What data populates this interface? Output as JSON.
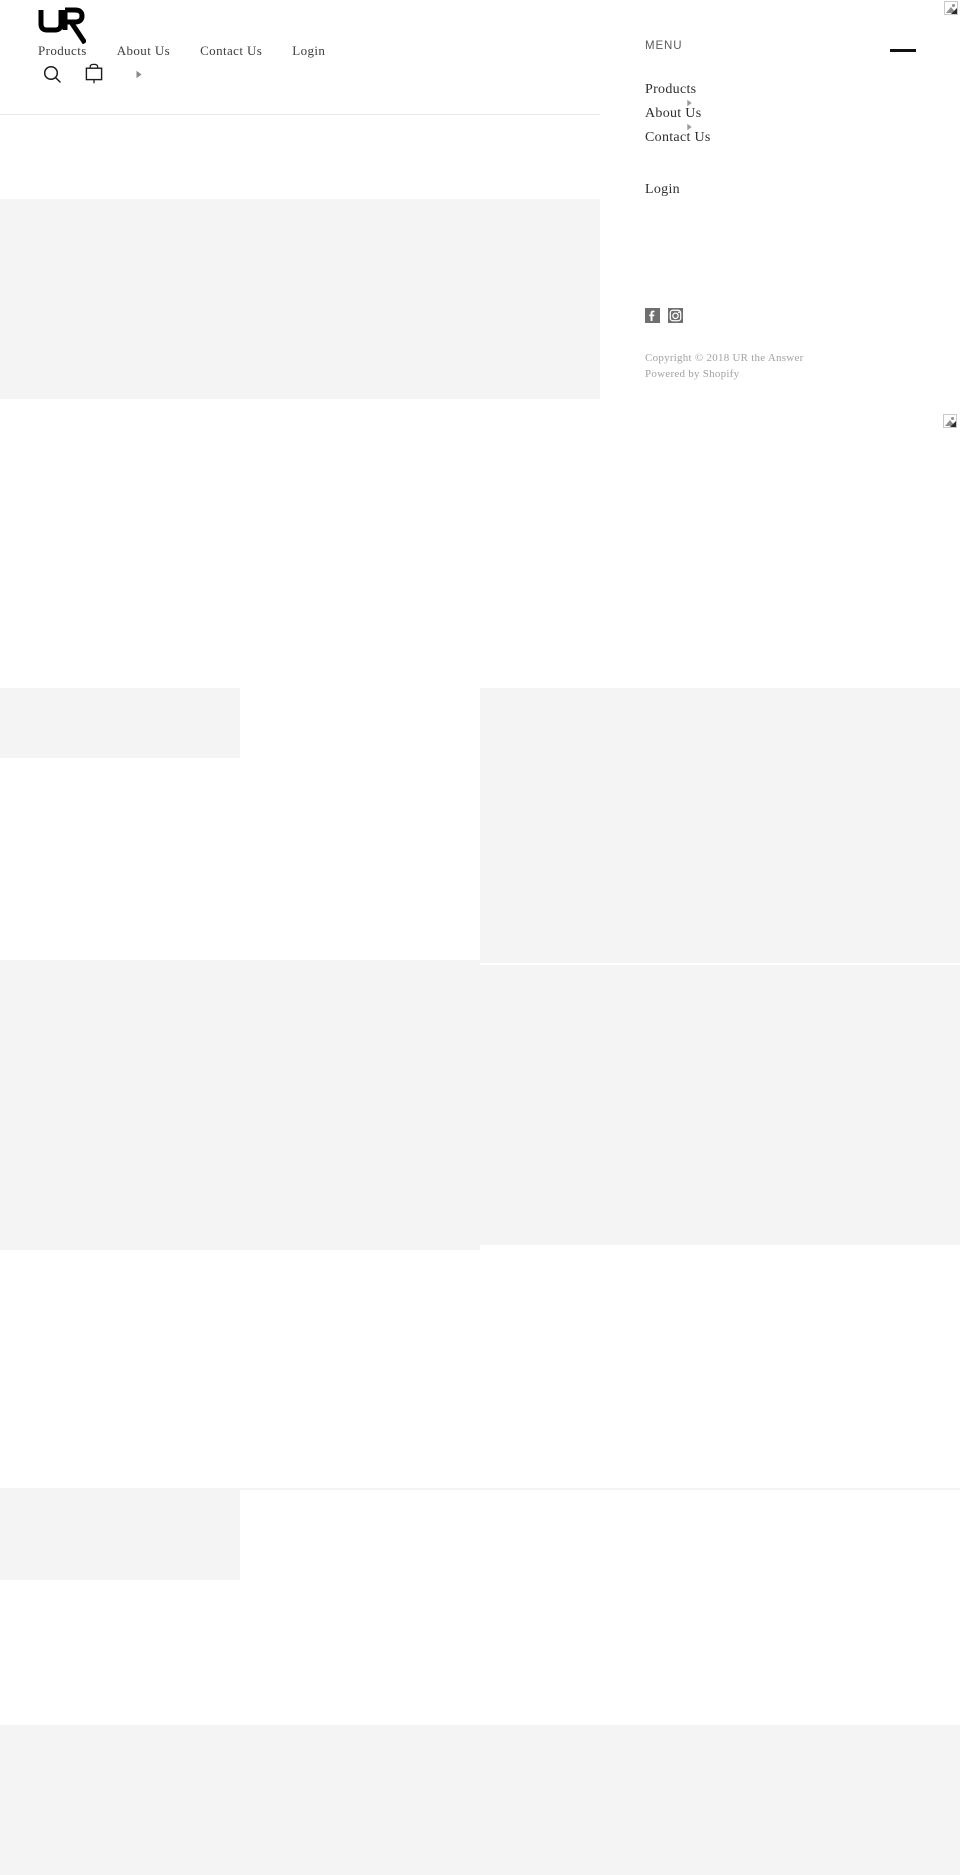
{
  "site": {
    "logo_alt": "UR",
    "brand": "UR the Answer"
  },
  "header": {
    "nav": [
      {
        "label": "Products",
        "name": "nav-link-products"
      },
      {
        "label": "About Us",
        "name": "nav-link-about-us"
      },
      {
        "label": "Contact Us",
        "name": "nav-link-contact-us"
      },
      {
        "label": "Login",
        "name": "nav-link-login"
      }
    ],
    "utilities": [
      {
        "icon": "search-icon",
        "label": "Search"
      },
      {
        "icon": "shopping-bag-icon",
        "label": "Cart"
      },
      {
        "icon": "caret-right-icon",
        "label": "Expand cart"
      }
    ]
  },
  "menu_panel": {
    "title": "MENU",
    "toggle_icon": "hamburger-icon",
    "items": [
      {
        "label": "Products",
        "has_submenu": true
      },
      {
        "label": "About Us",
        "has_submenu": true
      },
      {
        "label": "Contact Us",
        "has_submenu": false
      }
    ],
    "login_label": "Login",
    "social": [
      {
        "icon": "facebook-icon",
        "label": "Facebook"
      },
      {
        "icon": "instagram-icon",
        "label": "Instagram"
      }
    ],
    "copyright_line": "Copyright © 2018 UR the Answer",
    "powered_by_prefix": "Powered by ",
    "powered_by_link": "Shopify"
  },
  "placeholders": {
    "broken_image_label": "Broken image"
  },
  "colors": {
    "page_background": "#ffffff",
    "placeholder_block": "#f4f4f4",
    "text_primary": "#2f2f2f",
    "text_muted": "#a2a2a2",
    "rule": "#e8e8e8",
    "ink": "#111111"
  }
}
